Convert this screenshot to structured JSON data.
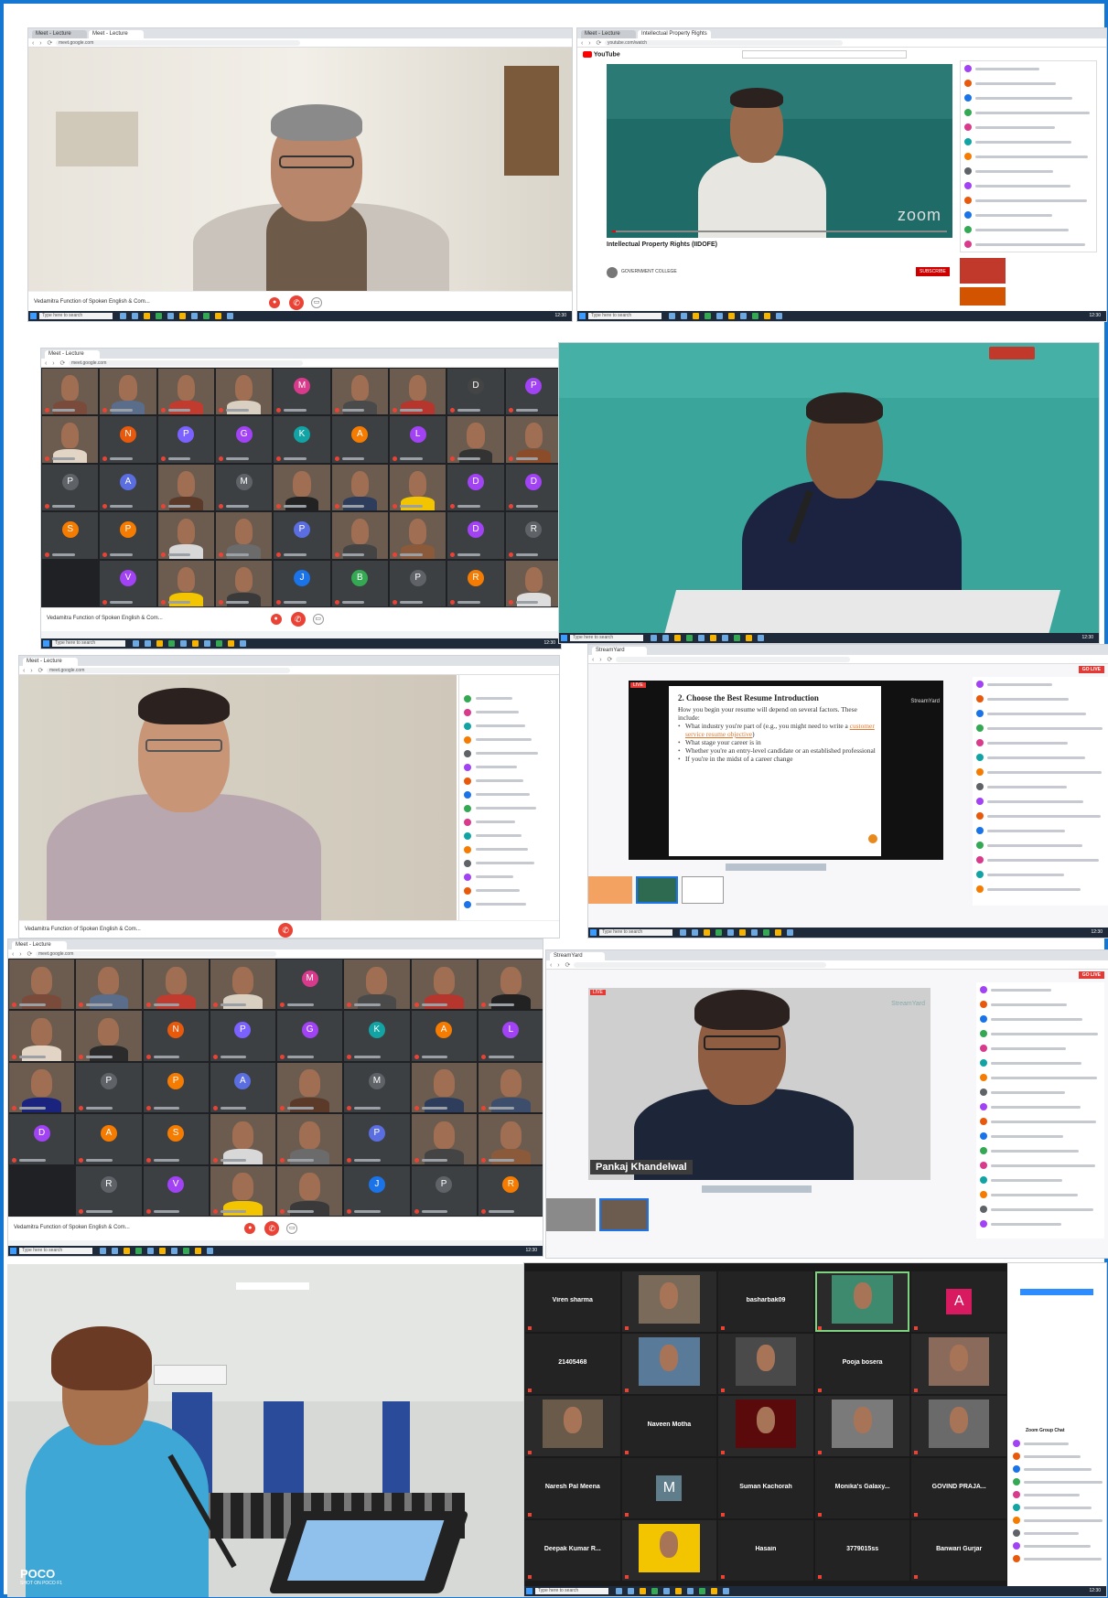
{
  "browser": {
    "meet_tab": "Meet - Lecture",
    "yt_tab": "Intellectual Property Rights",
    "meet_url": "meet.google.com",
    "yt_url": "youtube.com/watch",
    "search_placeholder": "Type here to search",
    "time": "12:30"
  },
  "meet": {
    "meeting_title": "Vedamitra Function of Spoken English & Com...",
    "end_icon": "phone-end-icon",
    "mic_icon": "mic-off-icon",
    "cam_icon": "camera-icon"
  },
  "youtube": {
    "logo": "YouTube",
    "video_title": "Intellectual Property Rights (IIDOFE)",
    "channel": "GOVERNMENT COLLEGE",
    "subscribe_label": "SUBSCRIBE",
    "watermark": "zoom"
  },
  "grid1": [
    {
      "type": "cam",
      "shirt": "#7a4b3a"
    },
    {
      "type": "cam",
      "shirt": "#5a6e8c"
    },
    {
      "type": "cam",
      "shirt": "#c23b2f"
    },
    {
      "type": "cam",
      "shirt": "#d9d0c1"
    },
    {
      "type": "av",
      "letter": "M",
      "color": "#d93a8c"
    },
    {
      "type": "cam",
      "shirt": "#4a4a4a"
    },
    {
      "type": "cam",
      "shirt": "#b6352d"
    },
    {
      "type": "av",
      "letter": "D",
      "color": "#444"
    },
    {
      "type": "av",
      "letter": "P",
      "color": "#a142f4"
    },
    {
      "type": "cam",
      "shirt": "#e3d5c5"
    },
    {
      "type": "av",
      "letter": "N",
      "color": "#e8590c"
    },
    {
      "type": "av",
      "letter": "P",
      "color": "#7b61ff"
    },
    {
      "type": "av",
      "letter": "G",
      "color": "#a142f4"
    },
    {
      "type": "av",
      "letter": "K",
      "color": "#12a4a4"
    },
    {
      "type": "av",
      "letter": "A",
      "color": "#f57c00"
    },
    {
      "type": "av",
      "letter": "L",
      "color": "#a142f4"
    },
    {
      "type": "cam",
      "shirt": "#333"
    },
    {
      "type": "cam",
      "shirt": "#8b4c2a"
    },
    {
      "type": "av",
      "letter": "P",
      "color": "#5f6368"
    },
    {
      "type": "av",
      "letter": "A",
      "color": "#5b6ee1"
    },
    {
      "type": "cam",
      "shirt": "#5b3a2a"
    },
    {
      "type": "av",
      "letter": "M",
      "color": "#5f6368"
    },
    {
      "type": "cam",
      "shirt": "#222"
    },
    {
      "type": "cam",
      "shirt": "#2e3d5c"
    },
    {
      "type": "cam",
      "shirt": "#f3c400"
    },
    {
      "type": "av",
      "letter": "D",
      "color": "#a142f4"
    },
    {
      "type": "av",
      "letter": "D",
      "color": "#a142f4"
    },
    {
      "type": "av",
      "letter": "S",
      "color": "#f57c00"
    },
    {
      "type": "av",
      "letter": "P",
      "color": "#f57c00"
    },
    {
      "type": "cam",
      "shirt": "#d8d8d8"
    },
    {
      "type": "cam",
      "shirt": "#6b6b6b"
    },
    {
      "type": "av",
      "letter": "P",
      "color": "#5b6ee1"
    },
    {
      "type": "cam",
      "shirt": "#444"
    },
    {
      "type": "cam",
      "shirt": "#8a5a3a"
    },
    {
      "type": "av",
      "letter": "D",
      "color": "#a142f4"
    },
    {
      "type": "av",
      "letter": "R",
      "color": "#5f6368"
    },
    {
      "type": "none"
    },
    {
      "type": "av",
      "letter": "V",
      "color": "#a142f4"
    },
    {
      "type": "cam",
      "shirt": "#f3c400"
    },
    {
      "type": "cam",
      "shirt": "#3a3a3a"
    },
    {
      "type": "av",
      "letter": "J",
      "color": "#1a73e8"
    },
    {
      "type": "av",
      "letter": "B",
      "color": "#34a853"
    },
    {
      "type": "av",
      "letter": "P",
      "color": "#5f6368"
    },
    {
      "type": "av",
      "letter": "R",
      "color": "#f57c00"
    },
    {
      "type": "cam",
      "shirt": "#ddd"
    }
  ],
  "grid2": [
    {
      "type": "cam",
      "shirt": "#7a4b3a"
    },
    {
      "type": "cam",
      "shirt": "#5a6e8c"
    },
    {
      "type": "cam",
      "shirt": "#c23b2f"
    },
    {
      "type": "cam",
      "shirt": "#d9d0c1"
    },
    {
      "type": "av",
      "letter": "M",
      "color": "#d93a8c"
    },
    {
      "type": "cam",
      "shirt": "#4a4a4a"
    },
    {
      "type": "cam",
      "shirt": "#b6352d"
    },
    {
      "type": "cam",
      "shirt": "#222"
    },
    {
      "type": "cam",
      "shirt": "#e3d5c5"
    },
    {
      "type": "cam",
      "shirt": "#2b2b2b"
    },
    {
      "type": "av",
      "letter": "N",
      "color": "#e8590c"
    },
    {
      "type": "av",
      "letter": "P",
      "color": "#7b61ff"
    },
    {
      "type": "av",
      "letter": "G",
      "color": "#a142f4"
    },
    {
      "type": "av",
      "letter": "K",
      "color": "#12a4a4"
    },
    {
      "type": "av",
      "letter": "A",
      "color": "#f57c00"
    },
    {
      "type": "av",
      "letter": "L",
      "color": "#a142f4"
    },
    {
      "type": "cam",
      "shirt": "#1a237e"
    },
    {
      "type": "av",
      "letter": "P",
      "color": "#5f6368"
    },
    {
      "type": "av",
      "letter": "P",
      "color": "#f57c00"
    },
    {
      "type": "av",
      "letter": "A",
      "color": "#5b6ee1"
    },
    {
      "type": "cam",
      "shirt": "#5b3a2a"
    },
    {
      "type": "av",
      "letter": "M",
      "color": "#5f6368"
    },
    {
      "type": "cam",
      "shirt": "#2e3d5c"
    },
    {
      "type": "cam",
      "shirt": "#3d4d6c"
    },
    {
      "type": "av",
      "letter": "D",
      "color": "#a142f4"
    },
    {
      "type": "av",
      "letter": "A",
      "color": "#f57c00"
    },
    {
      "type": "av",
      "letter": "S",
      "color": "#f57c00"
    },
    {
      "type": "cam",
      "shirt": "#d8d8d8"
    },
    {
      "type": "cam",
      "shirt": "#6b6b6b"
    },
    {
      "type": "av",
      "letter": "P",
      "color": "#5b6ee1"
    },
    {
      "type": "cam",
      "shirt": "#444"
    },
    {
      "type": "cam",
      "shirt": "#8a5a3a"
    },
    {
      "type": "none"
    },
    {
      "type": "av",
      "letter": "R",
      "color": "#5f6368"
    },
    {
      "type": "av",
      "letter": "V",
      "color": "#a142f4"
    },
    {
      "type": "cam",
      "shirt": "#f3c400"
    },
    {
      "type": "cam",
      "shirt": "#3a3a3a"
    },
    {
      "type": "av",
      "letter": "J",
      "color": "#1a73e8"
    },
    {
      "type": "av",
      "letter": "P",
      "color": "#5f6368"
    },
    {
      "type": "av",
      "letter": "R",
      "color": "#f57c00"
    }
  ],
  "streamyard": {
    "brand": "StreamYard",
    "slide_title": "2. Choose the Best Resume Introduction",
    "slide_lines": [
      "How you begin your resume will depend on several factors. These include:",
      "What industry you're part of (e.g., you might need to write a ",
      "What stage your career is in",
      "Whether you're an entry-level candidate or an established professional",
      "If you're in the midst of a career change"
    ],
    "slide_link": "customer service resume objective",
    "presenter_name": "Pankaj Khandelwal",
    "live_label": "LIVE",
    "go_live": "GO LIVE"
  },
  "zoom": {
    "tiles": [
      {
        "type": "name",
        "label": "Viren sharma"
      },
      {
        "type": "cam",
        "color": "#7a6a5a"
      },
      {
        "type": "name",
        "label": "basharbak09"
      },
      {
        "type": "cam",
        "color": "#3e8a6e",
        "active": true
      },
      {
        "type": "av",
        "letter": "A",
        "color": "#d81b60"
      },
      {
        "type": "name",
        "label": "21405468"
      },
      {
        "type": "cam",
        "color": "#5a7a9a"
      },
      {
        "type": "cam",
        "color": "#4a4a4a"
      },
      {
        "type": "name",
        "label": "Pooja bosera"
      },
      {
        "type": "cam",
        "color": "#8a6a5a"
      },
      {
        "type": "cam",
        "color": "#6a5a4a"
      },
      {
        "type": "name",
        "label": "Naveen Motha"
      },
      {
        "type": "cam",
        "color": "#5a0a0a"
      },
      {
        "type": "cam",
        "color": "#7a7a7a"
      },
      {
        "type": "cam",
        "color": "#6a6a6a"
      },
      {
        "type": "name",
        "label": "Naresh Pal Meena"
      },
      {
        "type": "av",
        "letter": "M",
        "color": "#607d8b"
      },
      {
        "type": "name",
        "label": "Suman Kachorah"
      },
      {
        "type": "name",
        "label": "Monika's Galaxy..."
      },
      {
        "type": "name",
        "label": "GOVIND PRAJA..."
      },
      {
        "type": "name",
        "label": "Deepak Kumar R..."
      },
      {
        "type": "cam",
        "color": "#f3c400"
      },
      {
        "type": "name",
        "label": "Hasain"
      },
      {
        "type": "name",
        "label": "3779015ss"
      },
      {
        "type": "name",
        "label": "Banwari Gurjar"
      }
    ],
    "chat_title": "Zoom Group Chat"
  },
  "photo": {
    "watermark_1": "POCO",
    "watermark_2": "SHOT ON POCO F1"
  },
  "colors": {
    "border": "#1677d2",
    "meet_dark": "#202124",
    "end_red": "#ea4335",
    "teal_bg": "#3aa59b"
  }
}
